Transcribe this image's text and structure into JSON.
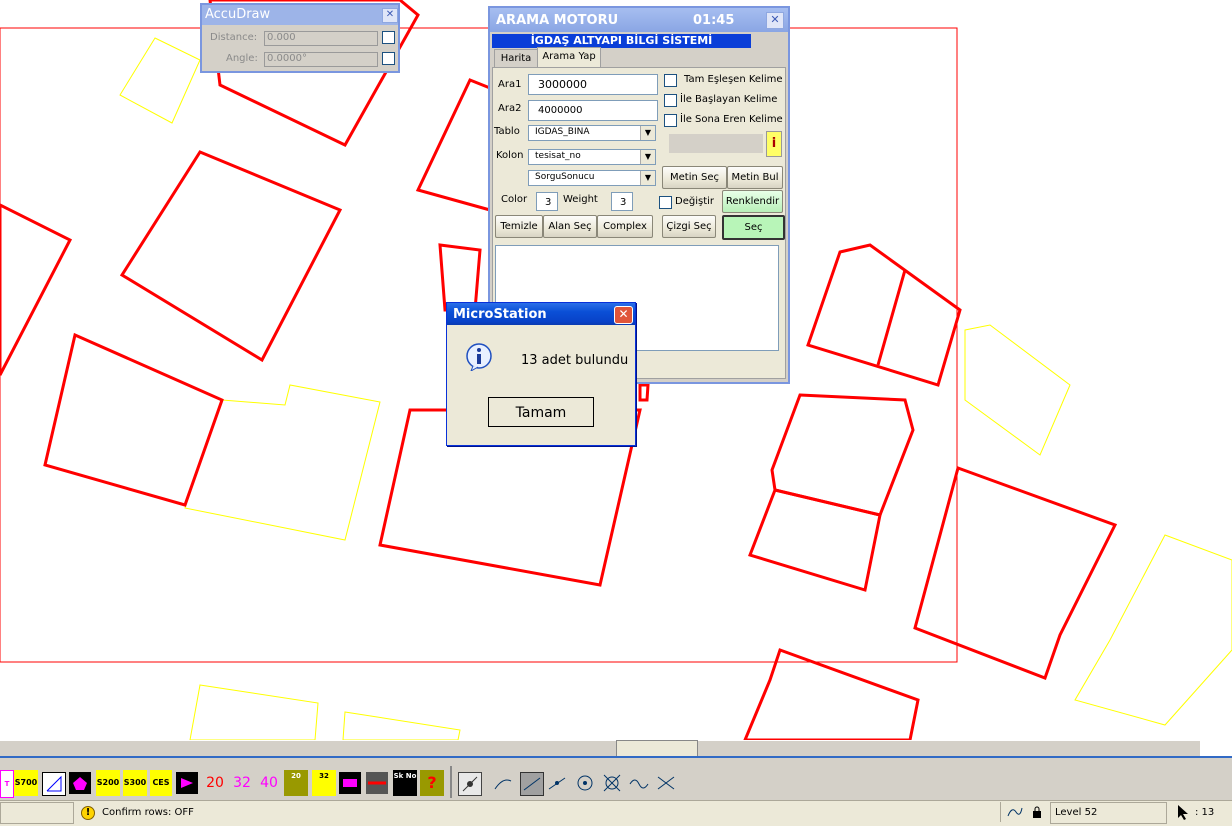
{
  "accudraw": {
    "title": "AccuDraw",
    "distance_label": "Distance:",
    "distance_value": "0.000",
    "angle_label": "Angle:",
    "angle_value": "0.0000°"
  },
  "arama": {
    "title": "ARAMA MOTORU",
    "time": "01:45",
    "banner": "İGDAŞ ALTYAPI BİLGİ SİSTEMİ",
    "tabs": [
      "Harita",
      "Arama Yap"
    ],
    "ara1_label": "Ara1",
    "ara1_value": "3000000",
    "ara2_label": "Ara2",
    "ara2_value": "4000000",
    "tablo_label": "Tablo",
    "tablo_value": "IGDAS_BINA",
    "kolon_label": "Kolon",
    "kolon_value": "tesisat_no",
    "sorgu_value": "SorguSonucu",
    "opt_tam": "Tam Eşleşen Kelime",
    "opt_ile_bas": "İle Başlayan Kelime",
    "opt_ile_son": "İle Sona Eren Kelime",
    "info_btn": "i",
    "color_label": "Color",
    "color_value": "3",
    "weight_label": "Weight",
    "weight_value": "3",
    "degistir": "Değiştir",
    "btn_metin_sec": "Metin Seç",
    "btn_metin_bul": "Metin Bul",
    "btn_renklendir": "Renklendir",
    "btn_temizle": "Temizle",
    "btn_alan_sec": "Alan Seç",
    "btn_complex": "Complex",
    "btn_cizgi_sec": "Çizgi Seç",
    "btn_sec": "Seç"
  },
  "msgbox": {
    "title": "MicroStation",
    "message": "13 adet bulundu",
    "ok_label": "Tamam"
  },
  "toolbar": {
    "items": [
      "S700",
      "S200",
      "S300",
      "CES",
      "20",
      "32",
      "40",
      "20",
      "32",
      "Sk No",
      "?"
    ]
  },
  "status": {
    "message": "Confirm rows: OFF",
    "level": "Level 52",
    "count": ": 13"
  },
  "colors": {
    "building_red": "#ff0000",
    "parcel_yellow": "#ffff00",
    "xp_title_blue": "#0a4fd6",
    "dialog_bg": "#ece9d8"
  }
}
